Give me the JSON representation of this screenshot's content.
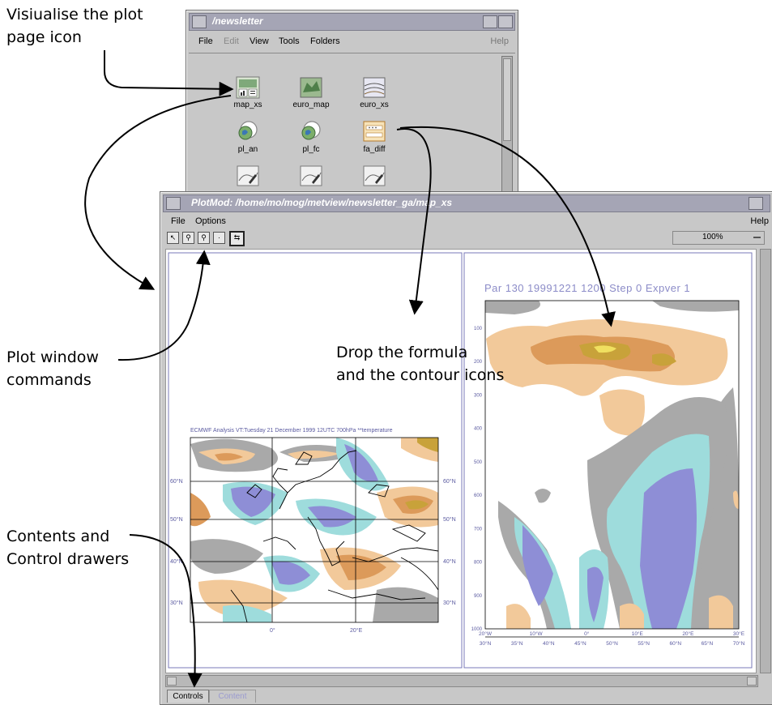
{
  "annotations": {
    "plot_page_icon": [
      "Visiualise the plot",
      "page icon"
    ],
    "plot_window_commands": [
      "Plot window",
      "commands"
    ],
    "drop_formula": [
      "Drop the formula",
      "and the contour icons"
    ],
    "drawers": [
      "Contents and",
      "Control drawers"
    ]
  },
  "folder_window": {
    "title": "/newsletter",
    "menu": {
      "file": "File",
      "edit": "Edit",
      "view": "View",
      "tools": "Tools",
      "folders": "Folders",
      "help": "Help"
    },
    "icons": [
      {
        "label": "map_xs"
      },
      {
        "label": "euro_map"
      },
      {
        "label": "euro_xs"
      },
      {
        "label": "pl_an"
      },
      {
        "label": "pl_fc"
      },
      {
        "label": "fa_diff"
      }
    ]
  },
  "plot_window": {
    "title": "PlotMod: /home/mo/mog/metview/newsletter_ga/map_xs",
    "menu": {
      "file": "File",
      "options": "Options",
      "help": "Help"
    },
    "zoom": "100%",
    "tabs": {
      "controls": "Controls",
      "content": "Content"
    }
  },
  "map_plot": {
    "title": "ECMWF  Analysis VT:Tuesday 21 December 1999 12UTC 700hPa **temperature",
    "lat_labels": [
      "60°N",
      "50°N",
      "40°N",
      "30°N"
    ],
    "lon_labels": [
      "0°",
      "20°E"
    ]
  },
  "xs_plot": {
    "title": "Par 130 19991221 1200 Step 0 Expver 1",
    "y_ticks": [
      "100",
      "200",
      "300",
      "400",
      "500",
      "600",
      "700",
      "800",
      "900",
      "1000"
    ],
    "x_lon": [
      "20°W",
      "10°W",
      "0°",
      "10°E",
      "20°E",
      "30°E"
    ],
    "x_lat": [
      "30°N",
      "35°N",
      "40°N",
      "45°N",
      "50°N",
      "55°N",
      "60°N",
      "65°N",
      "70°N"
    ]
  },
  "colors": {
    "warm_light": "#f2c99a",
    "warm_mid": "#dc9a5a",
    "warm_dark": "#c8a23a",
    "cold_light": "#9edcdc",
    "cold_mid": "#8e8ed6",
    "grey": "#a9a9a9",
    "axis": "#5a5aa0"
  }
}
